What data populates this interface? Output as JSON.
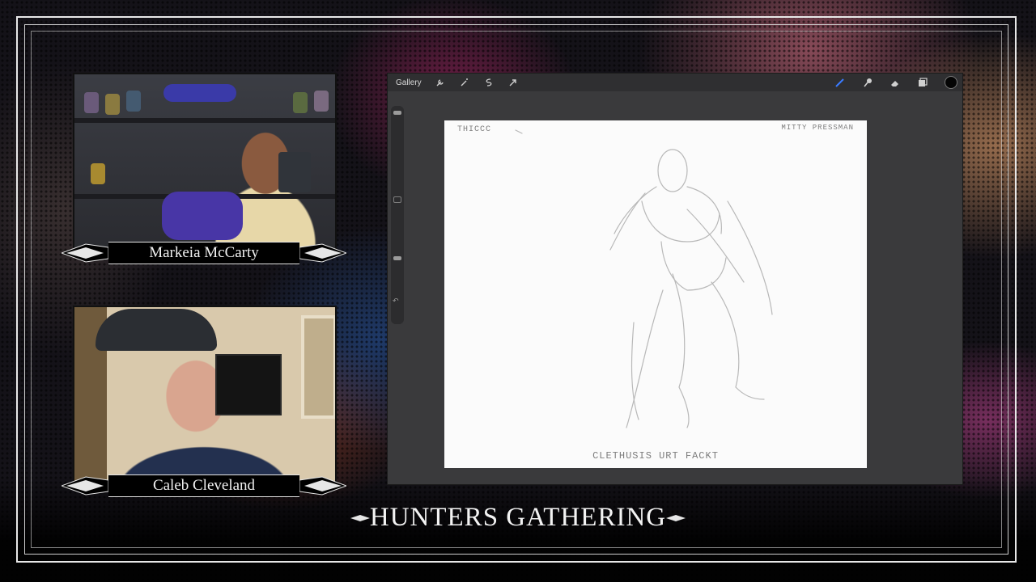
{
  "show": {
    "title": "HUNTERS GATHERING"
  },
  "participants": [
    {
      "name": "Markeia McCarty"
    },
    {
      "name": "Caleb Cleveland"
    }
  ],
  "app": {
    "gallery_label": "Gallery",
    "toolbar_left_icons": [
      "wrench-icon",
      "magic-wand-icon",
      "selection-icon",
      "move-arrow-icon"
    ],
    "toolbar_right_icons": [
      "brush-icon",
      "smudge-icon",
      "eraser-icon",
      "layers-icon",
      "color-swatch"
    ],
    "current_color": "#050505"
  },
  "canvas": {
    "note_top_left": "THICCC",
    "signature": "MITTY PRESSMAN",
    "caption": "CLETHUSIS URT FACKT"
  },
  "colors": {
    "frame": "#e8e8e8",
    "tablet_bg": "#3a3a3c",
    "canvas_bg": "#fbfbfb"
  }
}
